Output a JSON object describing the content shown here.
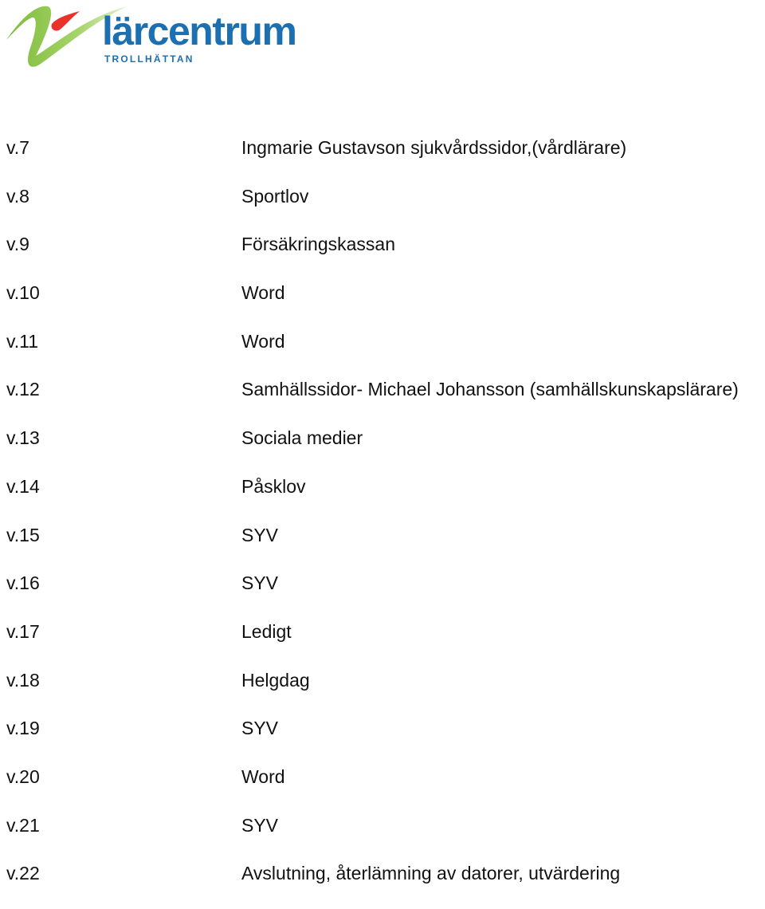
{
  "logo": {
    "name": "lärcentrum",
    "sub": "TROLLHÄTTAN",
    "colors": {
      "blue": "#1c6fb0",
      "green": "#8cc63f",
      "red": "#e8322b"
    }
  },
  "schedule": [
    {
      "week": "v.7",
      "text": "Ingmarie Gustavson sjukvårdssidor,(vårdlärare)"
    },
    {
      "week": "v.8",
      "text": "Sportlov"
    },
    {
      "week": "v.9",
      "text": "Försäkringskassan"
    },
    {
      "week": "v.10",
      "text": "Word"
    },
    {
      "week": "v.11",
      "text": "Word"
    },
    {
      "week": "v.12",
      "text": "Samhällssidor- Michael Johansson (samhällskunskapslärare)"
    },
    {
      "week": "v.13",
      "text": "Sociala medier"
    },
    {
      "week": "v.14",
      "text": "Påsklov"
    },
    {
      "week": "v.15",
      "text": "SYV"
    },
    {
      "week": "v.16",
      "text": "SYV"
    },
    {
      "week": "v.17",
      "text": "Ledigt"
    },
    {
      "week": "v.18",
      "text": "Helgdag"
    },
    {
      "week": "v.19",
      "text": "SYV"
    },
    {
      "week": "v.20",
      "text": "Word"
    },
    {
      "week": "v.21",
      "text": "SYV"
    },
    {
      "week": "v.22",
      "text": "Avslutning, återlämning av datorer, utvärdering"
    }
  ]
}
